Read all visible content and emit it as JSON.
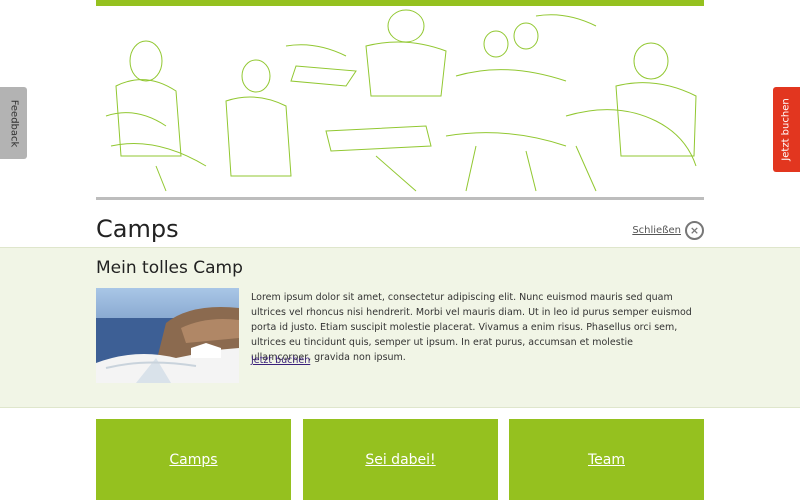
{
  "side_tabs": {
    "feedback": "Feedback",
    "book": "Jetzt buchen"
  },
  "hero": {
    "accent_color": "#95c11f",
    "image": "sketch-people-at-table"
  },
  "section": {
    "title": "Camps",
    "close_label": "Schließen"
  },
  "camp": {
    "title": "Mein tolles Camp",
    "image": "coastal-village-photo",
    "description": "Lorem ipsum dolor sit amet, consectetur adipiscing elit. Nunc euismod mauris sed quam ultrices vel rhoncus nisi hendrerit. Morbi vel mauris diam. Ut in leo id purus semper euismod porta id justo. Etiam suscipit molestie placerat. Vivamus a enim risus. Phasellus orci sem, ultrices eu tincidunt quis, semper ut ipsum. In erat purus, accumsan et molestie ullamcorper, gravida non ipsum.",
    "book_link": "Jetzt buchen"
  },
  "tiles": [
    {
      "label": "Camps"
    },
    {
      "label": "Sei dabei!"
    },
    {
      "label": "Team"
    }
  ],
  "colors": {
    "brand_green": "#95c11f",
    "book_red": "#e2361f",
    "panel_bg": "#f1f5e6"
  }
}
